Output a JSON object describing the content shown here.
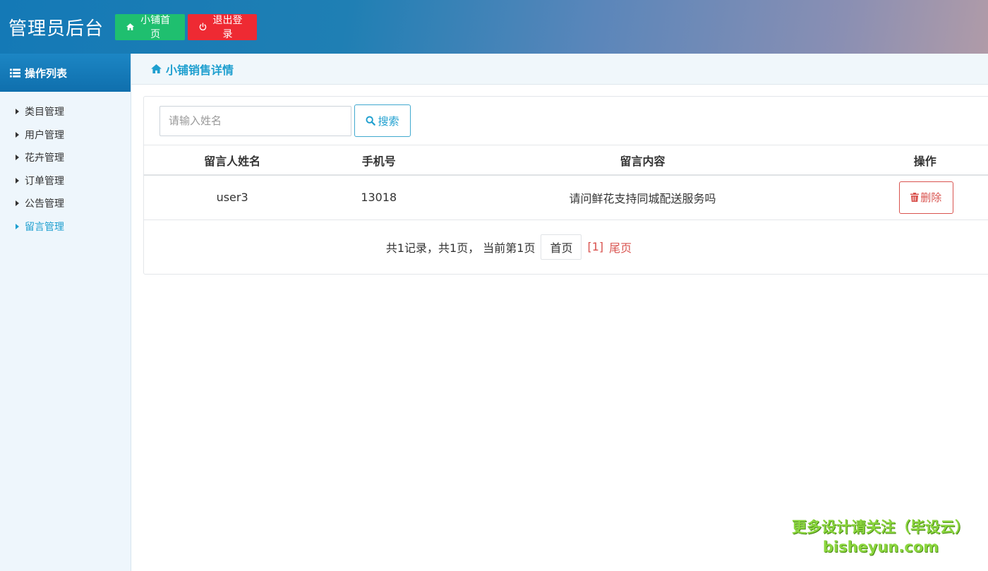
{
  "header": {
    "title": "管理员后台",
    "home_button": "小铺首页",
    "logout_button": "退出登录"
  },
  "sidebar": {
    "title": "操作列表",
    "items": [
      {
        "label": "类目管理"
      },
      {
        "label": "用户管理"
      },
      {
        "label": "花卉管理"
      },
      {
        "label": "订单管理"
      },
      {
        "label": "公告管理"
      },
      {
        "label": "留言管理",
        "active": true
      }
    ]
  },
  "main": {
    "title": "小铺销售详情",
    "search": {
      "placeholder": "请输入姓名",
      "value": "",
      "button": "搜索"
    },
    "table": {
      "headers": [
        "留言人姓名",
        "手机号",
        "留言内容",
        "操作"
      ],
      "rows": [
        {
          "name": "user3",
          "phone": "13018",
          "content": "请问鲜花支持同城配送服务吗",
          "action": "删除"
        }
      ]
    },
    "pager": {
      "info": "共1记录，共1页， 当前第1页",
      "first": "首页",
      "current": "[1]",
      "last": "尾页"
    }
  },
  "watermark": {
    "line1": "更多设计请关注（毕设云）",
    "line2": "bisheyun.com"
  },
  "colors": {
    "accent": "#1e9fcf",
    "home_button": "#1fbf6f",
    "logout_button": "#ee2a33",
    "danger": "#d9534f"
  }
}
